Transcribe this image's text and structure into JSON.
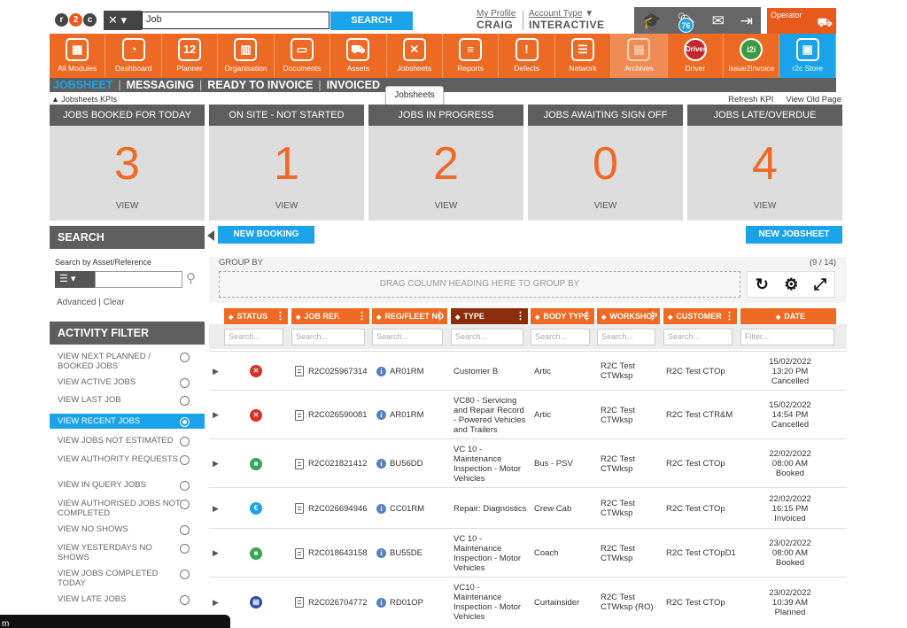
{
  "header": {
    "search_value": "Job",
    "search_button": "SEARCH",
    "profile_label": "My Profile",
    "profile_name": "CRAIG",
    "account_label": "Account Type",
    "account_value": "INTERACTIVE",
    "notification_count": "76",
    "operator_label": "Operator"
  },
  "nav": [
    {
      "label": "All Modules",
      "icon": "grid-icon",
      "glyph": "▦"
    },
    {
      "label": "Dashboard",
      "icon": "gauge-icon",
      "glyph": "◔"
    },
    {
      "label": "Planner",
      "icon": "calendar-icon",
      "glyph": "12"
    },
    {
      "label": "Organisation",
      "icon": "buildings-icon",
      "glyph": "▥"
    },
    {
      "label": "Documents",
      "icon": "folder-icon",
      "glyph": "▭"
    },
    {
      "label": "Assets",
      "icon": "truck-icon",
      "glyph": "⛟"
    },
    {
      "label": "Jobsheets",
      "icon": "tools-icon",
      "glyph": "✕"
    },
    {
      "label": "Reports",
      "icon": "clipboard-icon",
      "glyph": "≡"
    },
    {
      "label": "Defects",
      "icon": "warning-icon",
      "glyph": "!"
    },
    {
      "label": "Network",
      "icon": "contacts-icon",
      "glyph": "☰"
    },
    {
      "label": "Archives",
      "icon": "archive-icon",
      "glyph": "▤"
    },
    {
      "label": "Driver",
      "icon": "driver-icon",
      "glyph": "Driver"
    },
    {
      "label": "Issue2Invoice",
      "icon": "i2i-icon",
      "glyph": "i2i"
    },
    {
      "label": "r2c Store",
      "icon": "briefcase-icon",
      "glyph": "▣"
    }
  ],
  "subnav": {
    "jobsheet": "JOBSHEET",
    "messaging": "MESSAGING",
    "ready_to_invoice": "READY TO INVOICE",
    "invoiced": "INVOICED"
  },
  "tooltip": "Jobsheets",
  "kpi": {
    "label": "Jobsheets KPIs",
    "refresh": "Refresh KPI",
    "view_old": "View Old Page",
    "cards": [
      {
        "title": "JOBS BOOKED FOR TODAY",
        "value": "3",
        "view": "VIEW"
      },
      {
        "title": "ON SITE - NOT STARTED",
        "value": "1",
        "view": "VIEW"
      },
      {
        "title": "JOBS IN PROGRESS",
        "value": "2",
        "view": "VIEW"
      },
      {
        "title": "JOBS AWAITING SIGN OFF",
        "value": "0",
        "view": "VIEW"
      },
      {
        "title": "JOBS LATE/OVERDUE",
        "value": "4",
        "view": "VIEW"
      }
    ]
  },
  "sidebar": {
    "search_title": "SEARCH",
    "search_label": "Search by Asset/Reference",
    "advanced": "Advanced",
    "clear": "Clear",
    "filter_title": "ACTIVITY FILTER",
    "filters": [
      {
        "label": "VIEW NEXT PLANNED / BOOKED JOBS",
        "active": false
      },
      {
        "label": "VIEW ACTIVE JOBS",
        "active": false
      },
      {
        "label": "VIEW LAST JOB",
        "active": false
      },
      {
        "label": "VIEW RECENT JOBS",
        "active": true
      },
      {
        "label": "VIEW JOBS NOT ESTIMATED",
        "active": false
      },
      {
        "label": "VIEW AUTHORITY REQUESTS",
        "active": false
      },
      {
        "label": "VIEW IN QUERY JOBS",
        "active": false
      },
      {
        "label": "VIEW AUTHORISED JOBS NOT COMPLETED",
        "active": false
      },
      {
        "label": "VIEW NO SHOWS",
        "active": false
      },
      {
        "label": "VIEW YESTERDAYS NO SHOWS",
        "active": false
      },
      {
        "label": "VIEW JOBS COMPLETED TODAY",
        "active": false
      },
      {
        "label": "VIEW LATE JOBS",
        "active": false
      }
    ]
  },
  "toolbar": {
    "new_booking": "NEW BOOKING",
    "new_jobsheet": "NEW JOBSHEET",
    "group_by": "GROUP BY",
    "count": "(9 / 14)",
    "drop_hint": "DRAG COLUMN HEADING HERE TO GROUP BY"
  },
  "grid": {
    "columns": [
      "STATUS",
      "JOB REF.",
      "REG/FLEET NO",
      "TYPE",
      "BODY TYPE",
      "WORKSHOP",
      "CUSTOMER",
      "DATE"
    ],
    "search_placeholder": "Search...",
    "filter_placeholder": "Filter...",
    "rows": [
      {
        "status": "cancelled",
        "status_color": "#d9302c",
        "job_ref": "R2C025967314",
        "reg": "AR01RM",
        "type": "Customer B",
        "body": "Artic",
        "workshop": "R2C Test CTWksp",
        "customer": "R2C Test CTOp",
        "date": "15/02/2022",
        "time": "13:20 PM",
        "state": "Cancelled"
      },
      {
        "status": "cancelled",
        "status_color": "#d9302c",
        "job_ref": "R2C026590081",
        "reg": "AR01RM",
        "type": "VC80 - Servicing and Repair Record - Powered Vehicles and Trailers",
        "body": "Artic",
        "workshop": "R2C Test CTWksp",
        "customer": "R2C Test CTR&M",
        "date": "15/02/2022",
        "time": "14:54 PM",
        "state": "Cancelled"
      },
      {
        "status": "booked",
        "status_color": "#3aa655",
        "job_ref": "R2C021821412",
        "reg": "BU56DD",
        "type": "VC 10 - Maintenance Inspection - Motor Vehicles",
        "body": "Bus - PSV",
        "workshop": "R2C Test CTWksp",
        "customer": "R2C Test CTOp",
        "date": "22/02/2022",
        "time": "08:00 AM",
        "state": "Booked"
      },
      {
        "status": "invoiced",
        "status_color": "#1aa3e8",
        "job_ref": "R2C026694946",
        "reg": "CC01RM",
        "type": "Repair: Diagnostics",
        "body": "Crew Cab",
        "workshop": "R2C Test CTWksp",
        "customer": "R2C Test CTOp",
        "date": "22/02/2022",
        "time": "16:15 PM",
        "state": "Invoiced"
      },
      {
        "status": "booked",
        "status_color": "#3aa655",
        "job_ref": "R2C018643158",
        "reg": "BU55DE",
        "type": "VC 10 - Maintenance Inspection - Motor Vehicles",
        "body": "Coach",
        "workshop": "R2C Test CTWksp",
        "customer": "R2C Test CTOpD1",
        "date": "23/02/2022",
        "time": "08:00 AM",
        "state": "Booked"
      },
      {
        "status": "planned",
        "status_color": "#2b4ea8",
        "job_ref": "R2C026704772",
        "reg": "RD01OP",
        "type": "VC10 - Maintenance Inspection - Motor Vehicles",
        "body": "Curtainsider",
        "workshop": "R2C Test CTWksp (RO)",
        "customer": "R2C Test CTOp",
        "date": "23/02/2022",
        "time": "10:39 AM",
        "state": "Planned"
      }
    ]
  },
  "footer_text": "m"
}
